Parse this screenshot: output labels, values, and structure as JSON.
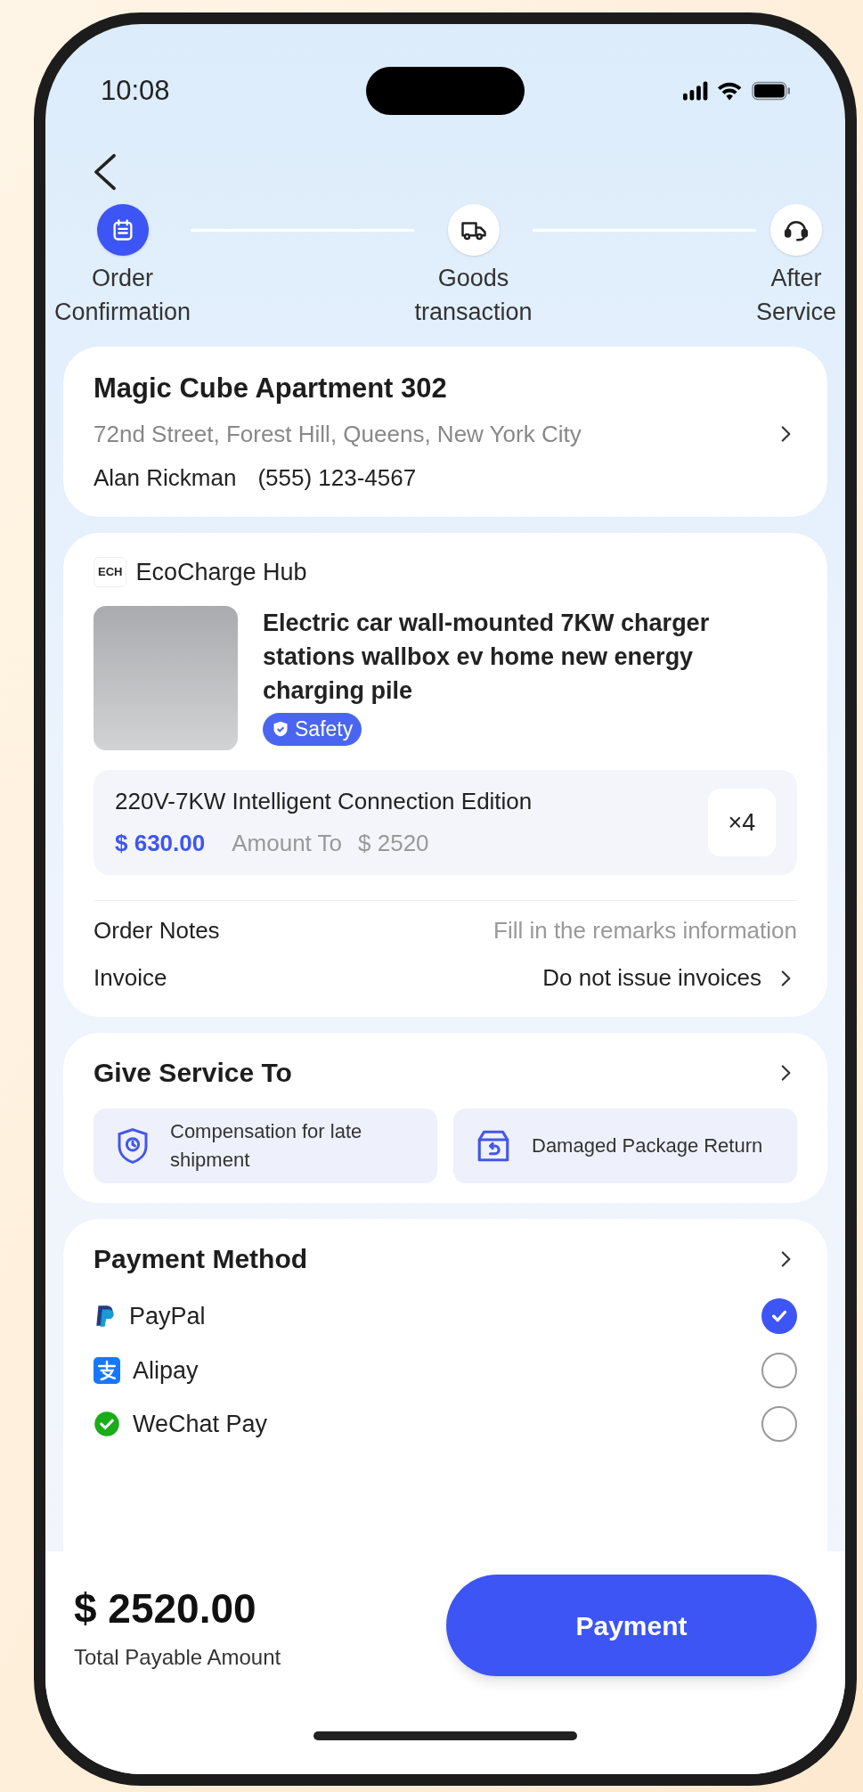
{
  "status_bar": {
    "time": "10:08"
  },
  "steps": [
    {
      "label": "Order Confirmation",
      "kind": "calendar",
      "selected": true
    },
    {
      "label": "Goods transaction",
      "kind": "truck",
      "selected": false
    },
    {
      "label": "After Service",
      "kind": "headset",
      "selected": false
    }
  ],
  "address": {
    "name": "Magic Cube Apartment 302",
    "street": "72nd Street, Forest Hill, Queens, New York City",
    "contact_name": "Alan Rickman",
    "phone": "(555) 123-4567"
  },
  "shop": {
    "logo": "ECH",
    "name": "EcoCharge Hub"
  },
  "product": {
    "title": "Electric car wall-mounted 7KW charger stations wallbox ev home new energy charging pile",
    "badge": "Safety",
    "variant": "220V-7KW Intelligent Connection Edition",
    "price": "$ 630.00",
    "amount_label": "Amount To",
    "amount": "$ 2520",
    "quantity": "×4"
  },
  "order_fields": [
    {
      "label": "Order Notes",
      "kind": "input",
      "placeholder": "Fill in the remarks information"
    },
    {
      "label": "Invoice",
      "kind": "select",
      "value": "Do not issue invoices"
    }
  ],
  "services": {
    "title": "Give Service To",
    "items": [
      {
        "label": "Compensation for late shipment",
        "kind": "shield-clock"
      },
      {
        "label": "Damaged Package Return",
        "kind": "box-return"
      }
    ]
  },
  "payment": {
    "title": "Payment Method",
    "options": [
      {
        "name": "PayPal",
        "kind": "paypal",
        "selected": true
      },
      {
        "name": "Alipay",
        "kind": "alipay",
        "selected": false
      },
      {
        "name": "WeChat Pay",
        "kind": "wechat",
        "selected": false
      }
    ]
  },
  "footer": {
    "total": "$ 2520.00",
    "total_label": "Total Payable Amount",
    "button": "Payment"
  }
}
